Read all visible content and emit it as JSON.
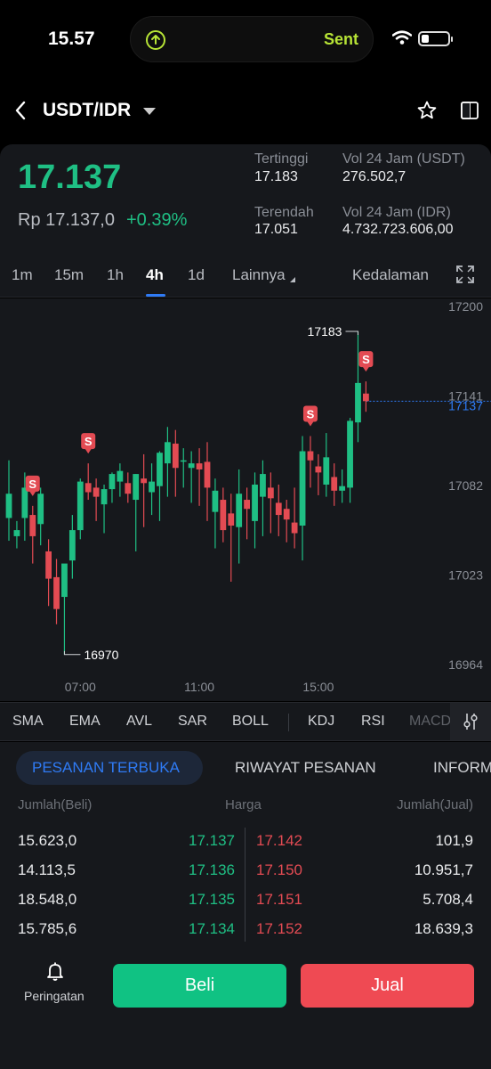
{
  "status_bar": {
    "time": "15.57",
    "activity_label": "Sent"
  },
  "header": {
    "pair": "USDT/IDR"
  },
  "ticker": {
    "last_price": "17.137",
    "rp_price": "Rp 17.137,0",
    "change": "+0.39%",
    "high_label": "Tertinggi",
    "high_value": "17.183",
    "low_label": "Terendah",
    "low_value": "17.051",
    "vol_usdt_label": "Vol 24 Jam (USDT)",
    "vol_usdt_value": "276.502,7",
    "vol_idr_label": "Vol 24 Jam (IDR)",
    "vol_idr_value": "4.732.723.606,00"
  },
  "timeframes": {
    "items": [
      "1m",
      "15m",
      "1h",
      "4h",
      "1d",
      "Lainnya"
    ],
    "active": "4h",
    "depth_label": "Kedalaman"
  },
  "colors": {
    "up": "#1fbf84",
    "down": "#e34b53",
    "accent": "#2f7bf5",
    "buy_button": "#10c283",
    "sell_button": "#ef4a53"
  },
  "chart_data": {
    "type": "candlestick",
    "y_ticks": [
      "17200",
      "17141",
      "17082",
      "17023",
      "16964"
    ],
    "x_ticks": [
      "07:00",
      "11:00",
      "15:00"
    ],
    "ylim": [
      16964,
      17200
    ],
    "current_price_label": "17137",
    "high_annotation": "17183",
    "low_annotation": "16970",
    "sell_marker_label": "S",
    "candles": [
      {
        "o": 17060,
        "h": 17098,
        "l": 17045,
        "c": 17076
      },
      {
        "o": 17048,
        "h": 17058,
        "l": 17040,
        "c": 17052
      },
      {
        "o": 17060,
        "h": 17090,
        "l": 17045,
        "c": 17080
      },
      {
        "o": 17062,
        "h": 17068,
        "l": 17030,
        "c": 17048
      },
      {
        "o": 17056,
        "h": 17080,
        "l": 17042,
        "c": 17076
      },
      {
        "o": 17038,
        "h": 17046,
        "l": 17002,
        "c": 17020
      },
      {
        "o": 17021,
        "h": 17033,
        "l": 16990,
        "c": 17000
      },
      {
        "o": 17008,
        "h": 17024,
        "l": 16970,
        "c": 17030
      },
      {
        "o": 17032,
        "h": 17062,
        "l": 17020,
        "c": 17052
      },
      {
        "o": 17052,
        "h": 17086,
        "l": 17046,
        "c": 17084
      },
      {
        "o": 17083,
        "h": 17096,
        "l": 17072,
        "c": 17077
      },
      {
        "o": 17080,
        "h": 17086,
        "l": 17058,
        "c": 17074
      },
      {
        "o": 17069,
        "h": 17082,
        "l": 17050,
        "c": 17079
      },
      {
        "o": 17079,
        "h": 17090,
        "l": 17070,
        "c": 17089
      },
      {
        "o": 17084,
        "h": 17096,
        "l": 17074,
        "c": 17091
      },
      {
        "o": 17083,
        "h": 17090,
        "l": 17070,
        "c": 17076
      },
      {
        "o": 17072,
        "h": 17089,
        "l": 17038,
        "c": 17089
      },
      {
        "o": 17086,
        "h": 17102,
        "l": 17054,
        "c": 17083
      },
      {
        "o": 17077,
        "h": 17096,
        "l": 17062,
        "c": 17084
      },
      {
        "o": 17081,
        "h": 17104,
        "l": 17058,
        "c": 17103
      },
      {
        "o": 17096,
        "h": 17120,
        "l": 17074,
        "c": 17110
      },
      {
        "o": 17109,
        "h": 17118,
        "l": 17074,
        "c": 17093
      },
      {
        "o": 17098,
        "h": 17106,
        "l": 17080,
        "c": 17098
      },
      {
        "o": 17093,
        "h": 17104,
        "l": 17070,
        "c": 17096
      },
      {
        "o": 17096,
        "h": 17106,
        "l": 17068,
        "c": 17092
      },
      {
        "o": 17097,
        "h": 17110,
        "l": 17058,
        "c": 17080
      },
      {
        "o": 17064,
        "h": 17086,
        "l": 17040,
        "c": 17078
      },
      {
        "o": 17072,
        "h": 17080,
        "l": 17044,
        "c": 17052
      },
      {
        "o": 17063,
        "h": 17076,
        "l": 17018,
        "c": 17055
      },
      {
        "o": 17054,
        "h": 17092,
        "l": 17030,
        "c": 17076
      },
      {
        "o": 17072,
        "h": 17080,
        "l": 17046,
        "c": 17066
      },
      {
        "o": 17058,
        "h": 17090,
        "l": 17040,
        "c": 17082
      },
      {
        "o": 17074,
        "h": 17098,
        "l": 17048,
        "c": 17089
      },
      {
        "o": 17080,
        "h": 17090,
        "l": 17050,
        "c": 17073
      },
      {
        "o": 17070,
        "h": 17082,
        "l": 17048,
        "c": 17062
      },
      {
        "o": 17066,
        "h": 17072,
        "l": 17044,
        "c": 17059
      },
      {
        "o": 17057,
        "h": 17080,
        "l": 17040,
        "c": 17050
      },
      {
        "o": 17055,
        "h": 17114,
        "l": 17032,
        "c": 17104
      },
      {
        "o": 17104,
        "h": 17114,
        "l": 17080,
        "c": 17098
      },
      {
        "o": 17094,
        "h": 17102,
        "l": 17075,
        "c": 17090
      },
      {
        "o": 17082,
        "h": 17116,
        "l": 17074,
        "c": 17100
      },
      {
        "o": 17087,
        "h": 17096,
        "l": 17068,
        "c": 17078
      },
      {
        "o": 17078,
        "h": 17092,
        "l": 17070,
        "c": 17081
      },
      {
        "o": 17080,
        "h": 17126,
        "l": 17070,
        "c": 17124
      },
      {
        "o": 17123,
        "h": 17183,
        "l": 17110,
        "c": 17149
      },
      {
        "o": 17142,
        "h": 17150,
        "l": 17130,
        "c": 17137
      }
    ]
  },
  "indicators": [
    "SMA",
    "EMA",
    "AVL",
    "SAR",
    "BOLL",
    "KDJ",
    "RSI",
    "MACD"
  ],
  "order_tabs": [
    "PESANAN TERBUKA",
    "RIWAYAT PESANAN",
    "INFORMASI"
  ],
  "book": {
    "head_buy": "Jumlah(Beli)",
    "head_price": "Harga",
    "head_sell": "Jumlah(Jual)",
    "rows": [
      {
        "buy_qty": "15.623,0",
        "buy_price": "17.137",
        "sell_price": "17.142",
        "sell_qty": "101,9"
      },
      {
        "buy_qty": "14.113,5",
        "buy_price": "17.136",
        "sell_price": "17.150",
        "sell_qty": "10.951,7"
      },
      {
        "buy_qty": "18.548,0",
        "buy_price": "17.135",
        "sell_price": "17.151",
        "sell_qty": "5.708,4"
      },
      {
        "buy_qty": "15.785,6",
        "buy_price": "17.134",
        "sell_price": "17.152",
        "sell_qty": "18.639,3"
      }
    ]
  },
  "bottom": {
    "alert_label": "Peringatan",
    "buy_label": "Beli",
    "sell_label": "Jual"
  }
}
